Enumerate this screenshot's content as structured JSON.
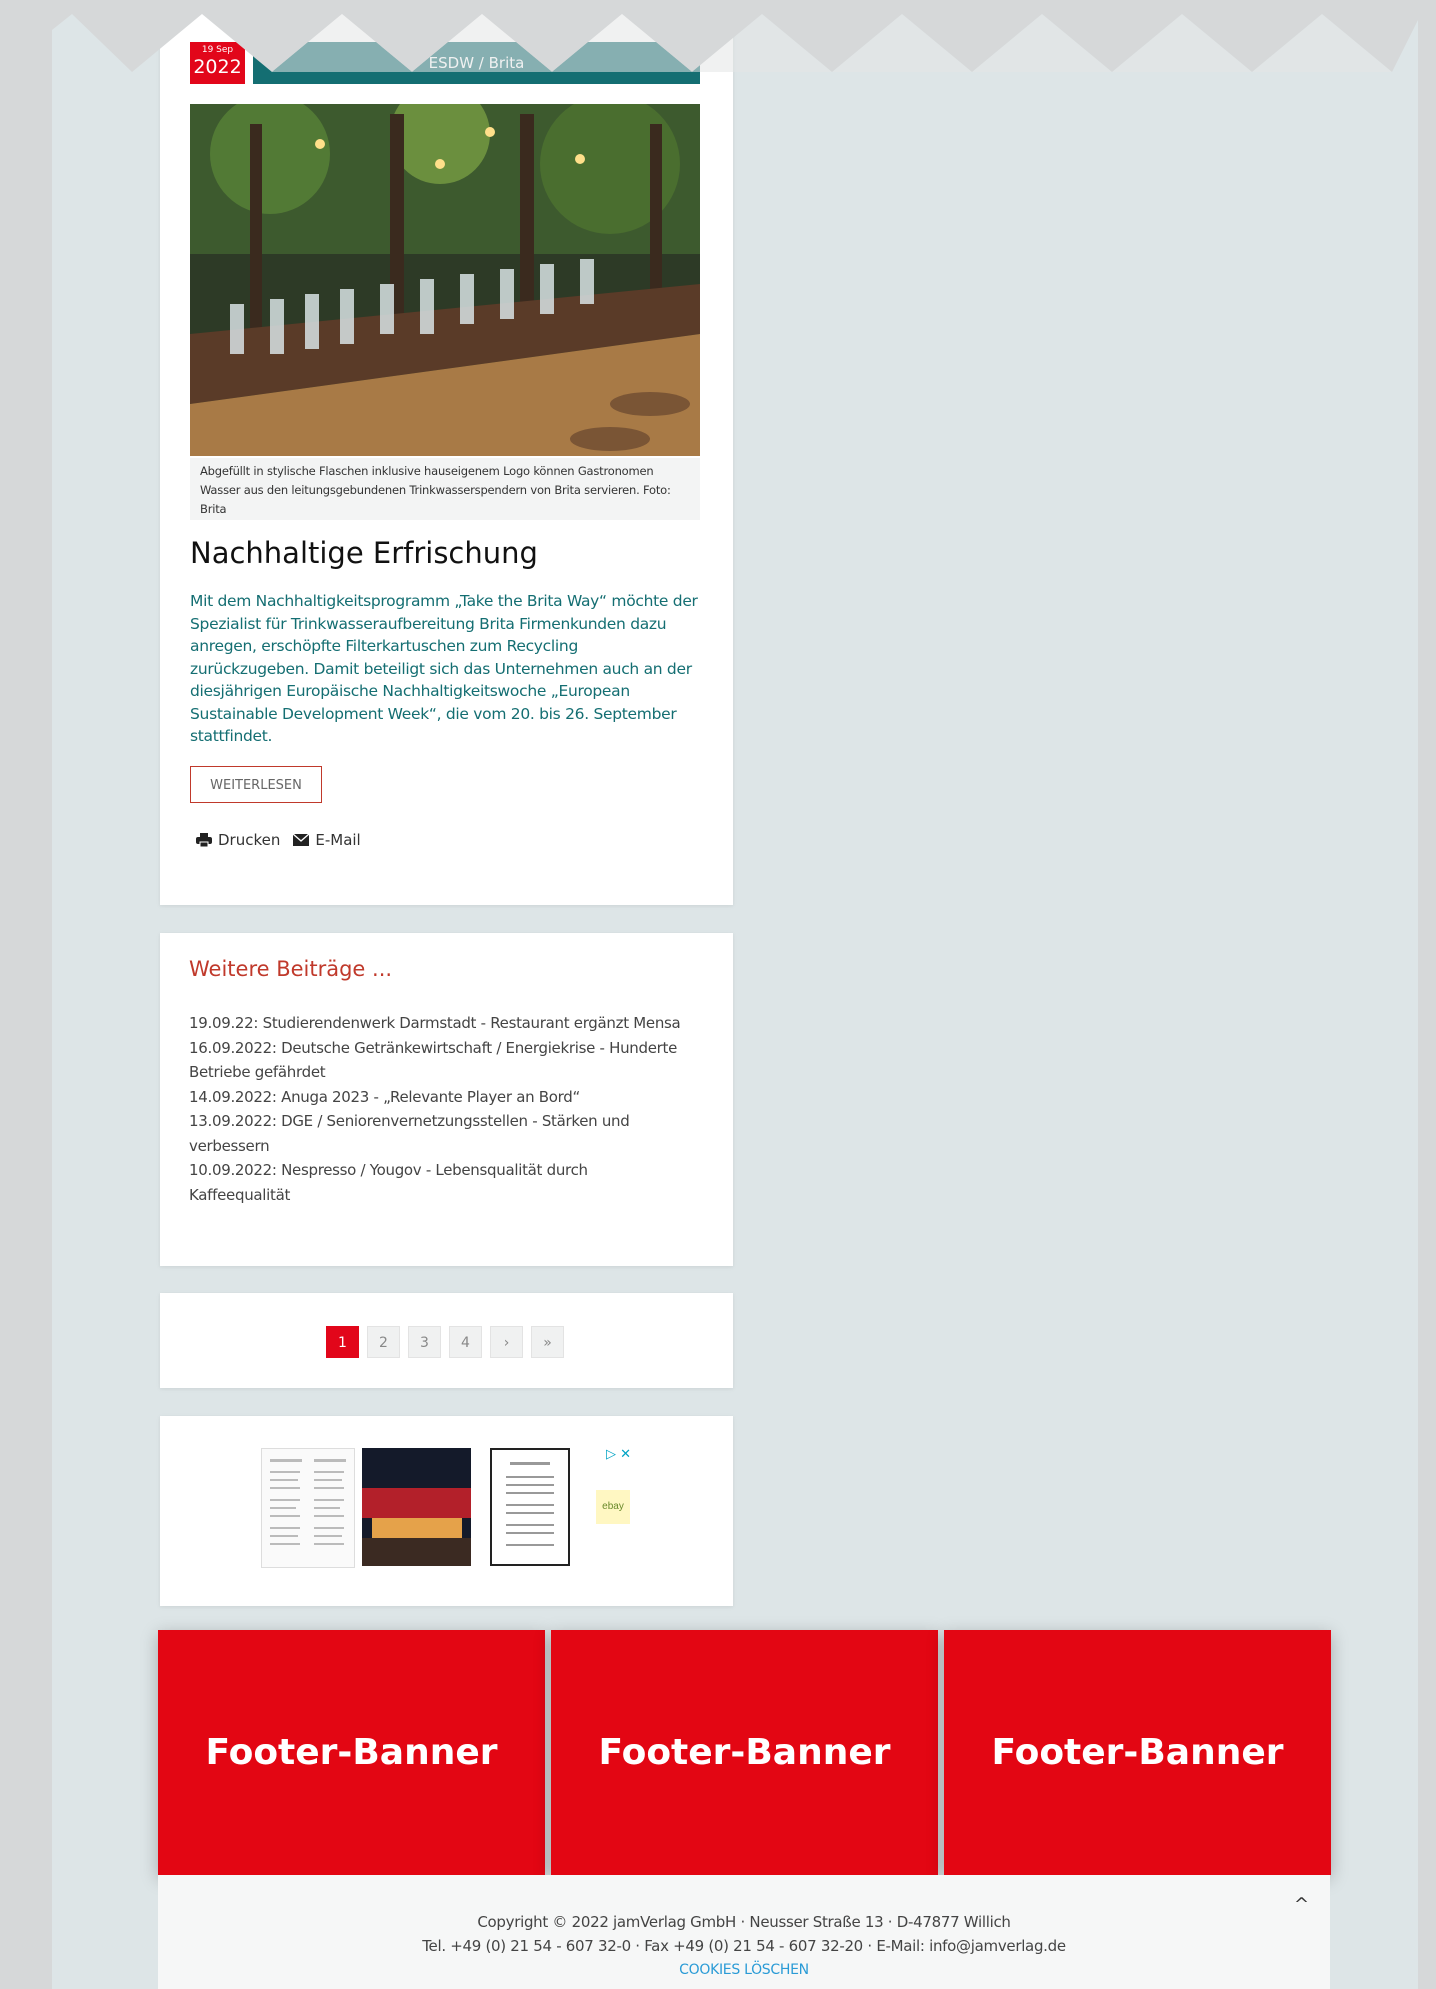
{
  "article": {
    "date_day": "19 Sep",
    "date_year": "2022",
    "category": "ESDW / Brita",
    "image_alt": "Bar mit Flaschen",
    "caption": "Abgefüllt in stylische Flaschen inklusive hauseigenem Logo können Gastronomen Wasser aus den leitungsgebundenen Trinkwasserspendern von Brita servieren. Foto: Brita",
    "title": "Nachhaltige Erfrischung",
    "body": "Mit dem Nachhaltigkeitsprogramm „Take the Brita Way“ möchte der Spezialist für Trinkwasseraufbereitung Brita Firmenkunden dazu anregen, erschöpfte Filterkartuschen zum Recycling zurückzugeben. Damit beteiligt sich das Unternehmen auch an der diesjährigen Europäische Nachhaltigkeitswoche „European Sustainable Development Week“, die vom 20. bis 26. September stattfindet.",
    "read_more": "WEITERLESEN",
    "print_label": "Drucken",
    "email_label": "E-Mail"
  },
  "more": {
    "title": "Weitere Beiträge ...",
    "items": [
      "19.09.22: Studierendenwerk Darmstadt - Restaurant ergänzt Mensa",
      "16.09.2022: Deutsche Getränkewirtschaft / Energiekrise - Hunderte Betriebe gefährdet",
      "14.09.2022: Anuga 2023 - „Relevante Player an Bord“",
      "13.09.2022: DGE / Seniorenvernetzungsstellen - Stärken und verbessern",
      "10.09.2022: Nespresso / Yougov - Lebensqualität durch Kaffeequalität"
    ]
  },
  "pager": {
    "pages": [
      "1",
      "2",
      "3",
      "4"
    ],
    "next": "›",
    "last": "»",
    "active": "1"
  },
  "ad": {
    "label": "ebay",
    "close": "▷ ✕"
  },
  "banners": [
    "Footer-Banner",
    "Footer-Banner",
    "Footer-Banner"
  ],
  "footer": {
    "line1": "Copyright © 2022 jamVerlag GmbH · Neusser Straße 13 · D-47877 Willich",
    "line2": "Tel. +49 (0) 21 54 - 607 32-0 · Fax +49 (0) 21 54 - 607 32-20 · E-Mail: info@jamverlag.de",
    "cookies": "COOKIES LÖSCHEN",
    "to_top": "^"
  },
  "colors": {
    "accent_red": "#e2061a",
    "teal": "#146e72",
    "background": "#dde5e7"
  }
}
